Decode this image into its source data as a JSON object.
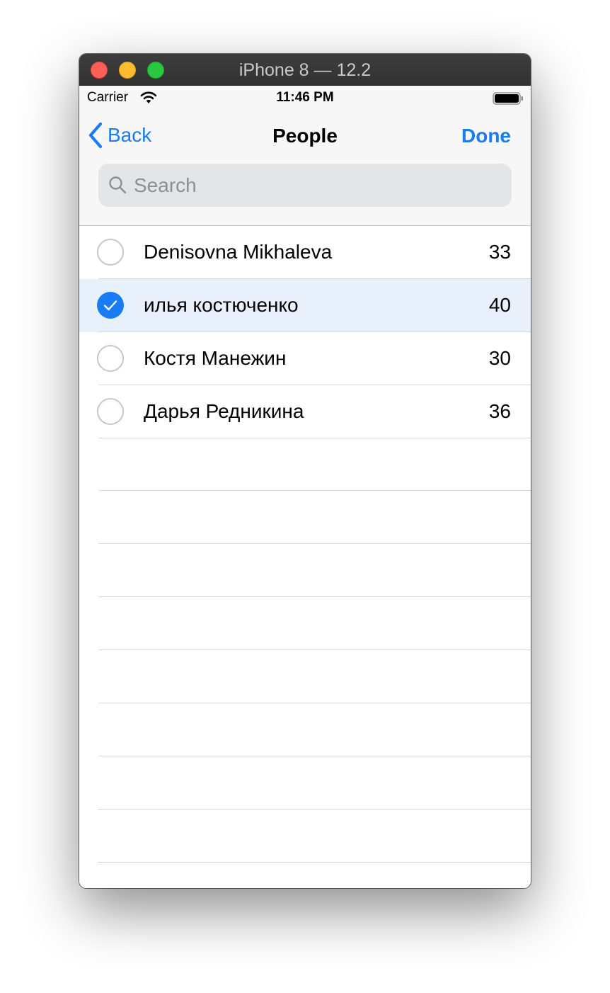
{
  "window": {
    "title": "iPhone 8 — 12.2"
  },
  "status_bar": {
    "carrier": "Carrier",
    "time": "11:46 PM",
    "wifi_icon": "wifi-icon",
    "battery_icon": "battery-icon"
  },
  "nav": {
    "back_label": "Back",
    "title": "People",
    "done_label": "Done"
  },
  "search": {
    "placeholder": "Search",
    "value": ""
  },
  "people": [
    {
      "name": "Denisovna Mikhaleva",
      "age": "33",
      "selected": false
    },
    {
      "name": "илья костюченко",
      "age": "40",
      "selected": true
    },
    {
      "name": "Костя Манежин",
      "age": "30",
      "selected": false
    },
    {
      "name": "Дарья Редникина",
      "age": "36",
      "selected": false
    }
  ],
  "colors": {
    "accent": "#1a7cf4",
    "selected_row": "#e8f0fb",
    "nav_background": "#f7f7f7",
    "search_background": "#e4e5e7"
  }
}
